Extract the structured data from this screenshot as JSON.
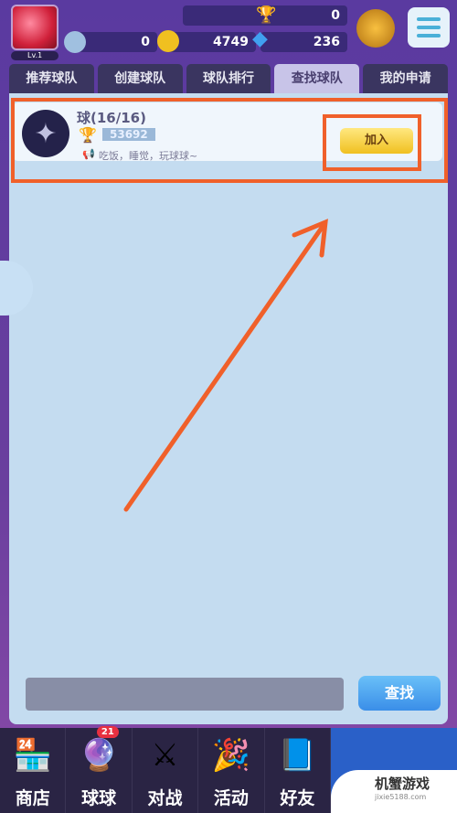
{
  "header": {
    "level": "Lv.1",
    "trophies": "0",
    "tickets": "0",
    "coins": "4749",
    "diamonds": "236"
  },
  "tabs": [
    {
      "label": "推荐球队"
    },
    {
      "label": "创建球队"
    },
    {
      "label": "球队排行"
    },
    {
      "label": "查找球队",
      "active": true
    },
    {
      "label": "我的申请"
    }
  ],
  "team": {
    "name": "球(16/16)",
    "trophies": "53692",
    "motto": "吃饭，睡觉，玩球球~",
    "join_label": "加入"
  },
  "search": {
    "value": "",
    "button": "查找"
  },
  "nav": [
    {
      "label": "商店",
      "icon": "shop-icon"
    },
    {
      "label": "球球",
      "icon": "ball-icon",
      "badge": "21"
    },
    {
      "label": "对战",
      "icon": "swords-icon"
    },
    {
      "label": "活动",
      "icon": "party-popper-icon"
    },
    {
      "label": "好友",
      "icon": "friends-book-icon"
    }
  ],
  "watermark": {
    "title": "机蟹游戏",
    "url": "jixie5188.com"
  },
  "colors": {
    "highlight": "#f0602a",
    "join": "#f0c020",
    "find": "#3a8ee8"
  }
}
